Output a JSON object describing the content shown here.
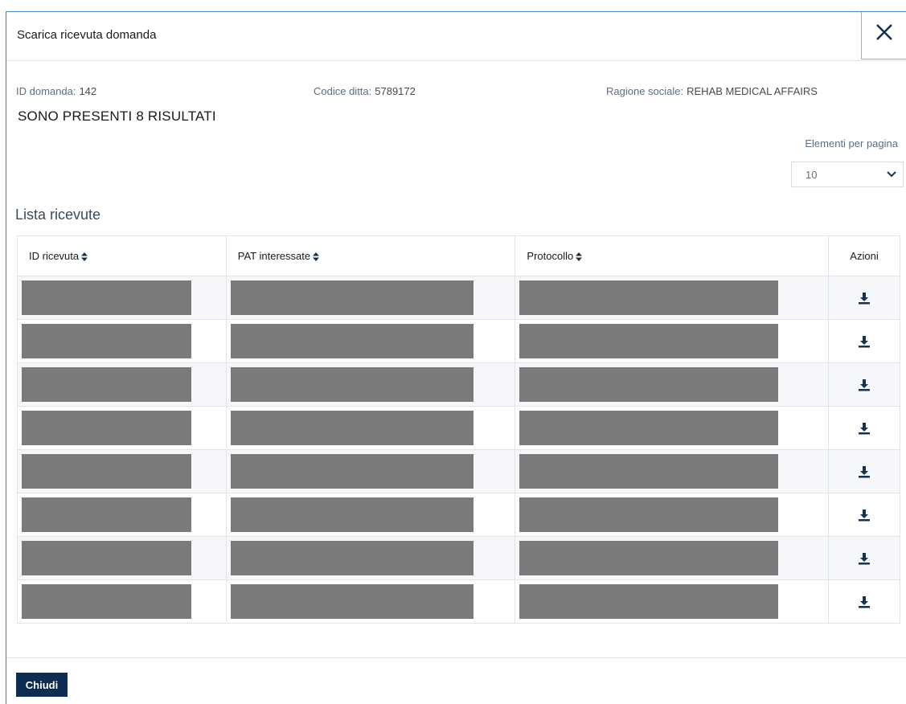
{
  "modal": {
    "title": "Scarica ricevuta domanda",
    "close_icon": "close-icon"
  },
  "meta": {
    "id_domanda_label": "ID domanda:",
    "id_domanda_value": "142",
    "codice_ditta_label": "Codice ditta:",
    "codice_ditta_value": "5789172",
    "ragione_sociale_label": "Ragione sociale:",
    "ragione_sociale_value": "REHAB MEDICAL AFFAIRS"
  },
  "results_title": "SONO PRESENTI 8 RISULTATI",
  "pagination": {
    "label": "Elementi per pagina",
    "selected": "10"
  },
  "list": {
    "title": "Lista ricevute",
    "columns": [
      "ID ricevuta",
      "PAT interessate",
      "Protocollo",
      "Azioni"
    ],
    "row_count": 8,
    "action_icon": "download-icon"
  },
  "footer": {
    "close_label": "Chiudi"
  },
  "colors": {
    "primary": "#0d2c52",
    "redaction": "#7a7a7a",
    "close_border": "#f0a14a"
  }
}
